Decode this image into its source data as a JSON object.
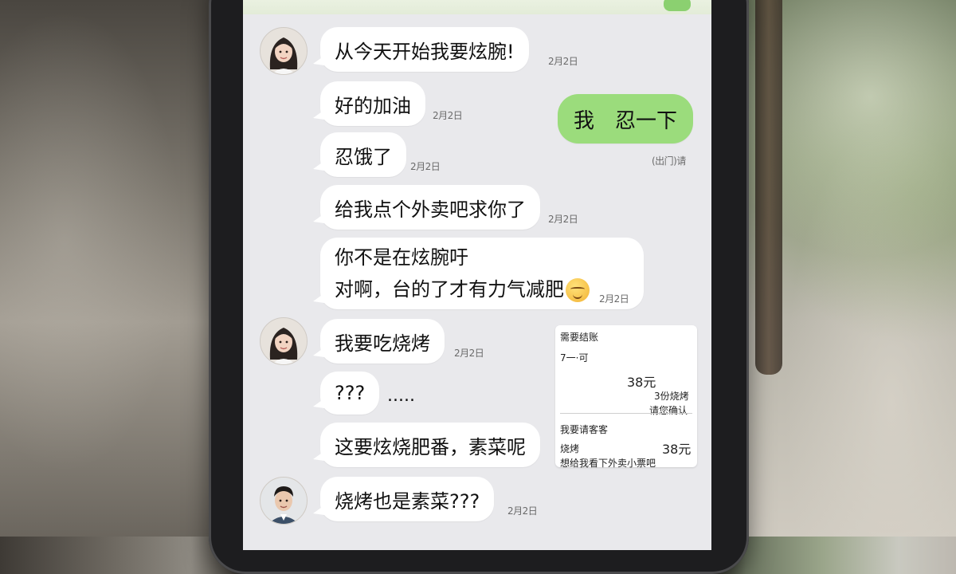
{
  "top_bar": {
    "accent_color": "#8bd070"
  },
  "messages": [
    {
      "side": "left",
      "text": "从今天开始我要炫腕!",
      "time": "2月2日",
      "avatar": "girl-avatar"
    },
    {
      "side": "left",
      "text": "好的加油",
      "time": "2月2日"
    },
    {
      "side": "right",
      "text": "我　忍一下",
      "time": "(出门)请"
    },
    {
      "side": "left",
      "text": "忍饿了",
      "time": "2月2日"
    },
    {
      "side": "left",
      "text": "给我点个外卖吧求你了",
      "time": "2月2日"
    },
    {
      "side": "left",
      "lines": [
        "你不是在炫腕吁",
        "对啊，台的了才有力气减肥"
      ],
      "time": "2月2日",
      "emoji": "smiling-face-icon"
    },
    {
      "side": "left",
      "text": "我要吃烧烤",
      "time": "2月2日",
      "avatar": "girl-avatar"
    },
    {
      "side": "left",
      "text": "???",
      "extra": "....."
    },
    {
      "side": "left",
      "text": "这要炫烧肥番，素菜呢"
    },
    {
      "side": "left",
      "text": "烧烤也是素菜???",
      "time": "2月2日",
      "avatar": "boy-avatar"
    }
  ],
  "receipt": {
    "title": "需要结账",
    "line1": "7一·可",
    "amount1": "38元",
    "note1": "3份烧烤",
    "note2": "请您确认",
    "section": "我要请客客",
    "label2": "烧烤",
    "amount2": "38元",
    "footer": "想给我看下外卖小票吧"
  },
  "colors": {
    "chat_bg": "#e9e9ec",
    "bubble_white": "#ffffff",
    "bubble_green": "#9bdc7c"
  }
}
